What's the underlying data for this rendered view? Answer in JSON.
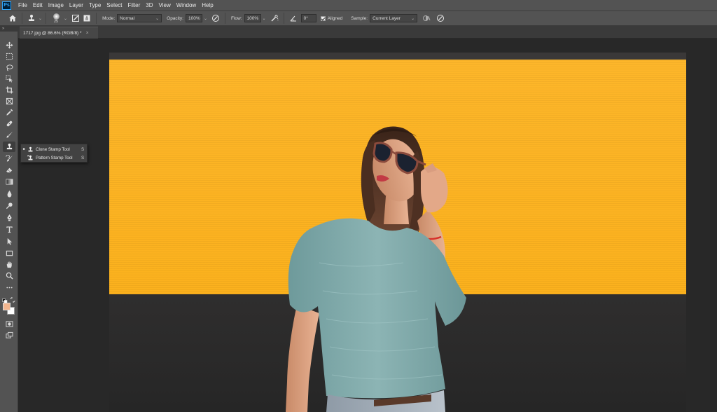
{
  "menubar": {
    "logo": "Ps",
    "items": [
      "File",
      "Edit",
      "Image",
      "Layer",
      "Type",
      "Select",
      "Filter",
      "3D",
      "View",
      "Window",
      "Help"
    ]
  },
  "options": {
    "brush_size": "25",
    "mode_label": "Mode:",
    "mode_value": "Normal",
    "opacity_label": "Opacity:",
    "opacity_value": "100%",
    "flow_label": "Flow:",
    "flow_value": "100%",
    "angle_value": "0°",
    "aligned_label": "Aligned",
    "sample_label": "Sample:",
    "sample_value": "Current Layer"
  },
  "document": {
    "tab_title": "1717.jpg @ 86.6% (RGB/8) *",
    "close": "×"
  },
  "flyout": {
    "items": [
      {
        "label": "Clone Stamp Tool",
        "key": "S",
        "selected": true
      },
      {
        "label": "Pattern Stamp Tool",
        "key": "S",
        "selected": false
      }
    ]
  },
  "colors": {
    "foreground": "#f2b58e",
    "background": "#ffffff",
    "wall": "#fbb11d",
    "sweater": "#7aa5a6"
  },
  "toolbar": {
    "collapse": "»",
    "icons": [
      "move-icon",
      "marquee-icon",
      "lasso-icon",
      "object-select-icon",
      "crop-icon",
      "frame-icon",
      "eyedropper-icon",
      "healing-brush-icon",
      "brush-icon",
      "clone-stamp-icon",
      "history-brush-icon",
      "eraser-icon",
      "gradient-icon",
      "blur-icon",
      "dodge-icon",
      "pen-icon",
      "type-icon",
      "path-select-icon",
      "rectangle-icon",
      "hand-icon",
      "zoom-icon",
      "more-icon",
      "quick-mask-icon",
      "screen-mode-icon"
    ]
  }
}
